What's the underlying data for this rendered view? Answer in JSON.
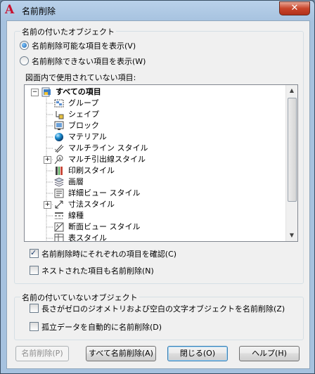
{
  "window": {
    "title": "名前削除",
    "app_icon": "autocad-a-icon",
    "close_glyph": "✕"
  },
  "named_group": {
    "label": "名前の付いたオブジェクト",
    "radio_purgeable": "名前削除可能な項目を表示(V)",
    "radio_nonpurgeable": "名前削除できない項目を表示(W)",
    "selected": "radio_purgeable",
    "list_caption": "図面内で使用されていない項目:",
    "tree": {
      "root": "すべての項目",
      "items": [
        {
          "label": "グループ",
          "icon": "group-icon",
          "expandable": false
        },
        {
          "label": "シェイプ",
          "icon": "shape-icon",
          "expandable": false
        },
        {
          "label": "ブロック",
          "icon": "block-icon",
          "expandable": false
        },
        {
          "label": "マテリアル",
          "icon": "material-sphere-icon",
          "expandable": false
        },
        {
          "label": "マルチライン スタイル",
          "icon": "multiline-style-icon",
          "expandable": false
        },
        {
          "label": "マルチ引出線スタイル",
          "icon": "multileader-style-icon",
          "expandable": true
        },
        {
          "label": "印刷スタイル",
          "icon": "plot-style-icon",
          "expandable": false
        },
        {
          "label": "画層",
          "icon": "layers-icon",
          "expandable": false
        },
        {
          "label": "詳細ビュー スタイル",
          "icon": "detail-view-style-icon",
          "expandable": false
        },
        {
          "label": "寸法スタイル",
          "icon": "dimension-style-icon",
          "expandable": true
        },
        {
          "label": "線種",
          "icon": "linetype-icon",
          "expandable": false
        },
        {
          "label": "断面ビュー スタイル",
          "icon": "section-view-style-icon",
          "expandable": false
        },
        {
          "label": "表スタイル",
          "icon": "table-style-icon",
          "expandable": false
        }
      ]
    },
    "check_confirm": "名前削除時にそれぞれの項目を確認(C)",
    "check_confirm_on": true,
    "check_nested": "ネストされた項目も名前削除(N)",
    "check_nested_on": false
  },
  "unnamed_group": {
    "label": "名前の付いていないオブジェクト",
    "check_zero_length": "長さがゼロのジオメトリおよび空白の文字オブジェクトを名前削除(Z)",
    "check_zero_length_on": false,
    "check_orphan": "孤立データを自動的に名前削除(D)",
    "check_orphan_on": false
  },
  "buttons": {
    "purge": "名前削除(P)",
    "purge_all": "すべて名前削除(A)",
    "close": "閉じる(O)",
    "help": "ヘルプ(H)"
  }
}
